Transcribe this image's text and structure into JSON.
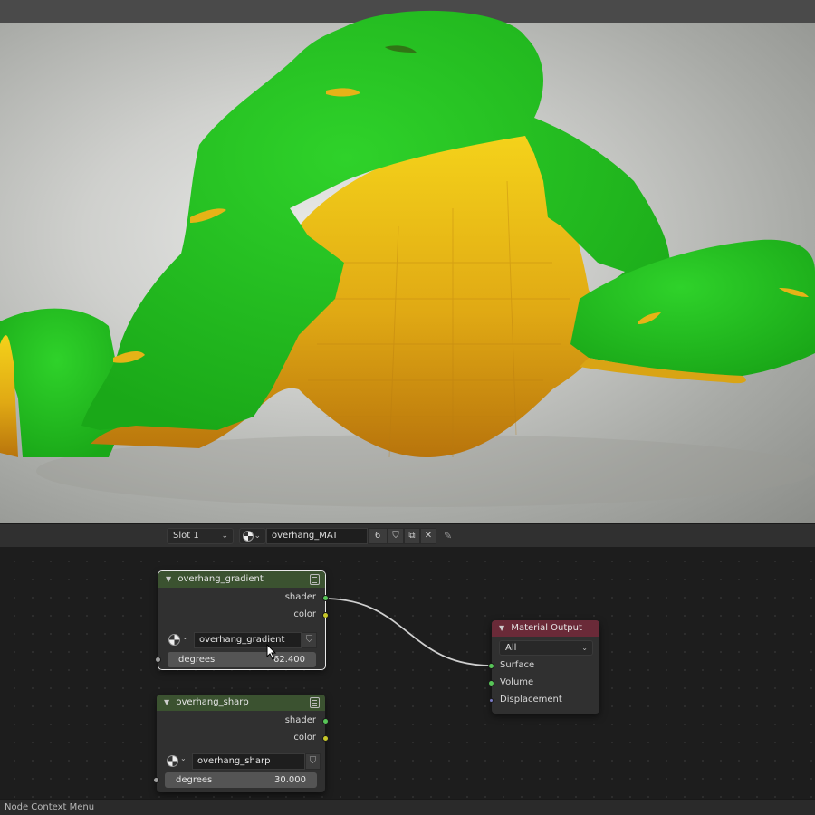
{
  "header": {
    "slot_label": "Slot 1",
    "material_name": "overhang_MAT",
    "user_count": "6"
  },
  "nodes": {
    "gradient": {
      "title": "overhang_gradient",
      "out_shader": "shader",
      "out_color": "color",
      "material": "overhang_gradient",
      "param_label": "degrees",
      "param_value": "62.400"
    },
    "sharp": {
      "title": "overhang_sharp",
      "out_shader": "shader",
      "out_color": "color",
      "material": "overhang_sharp",
      "param_label": "degrees",
      "param_value": "30.000"
    },
    "output": {
      "title": "Material Output",
      "target": "All",
      "in_surface": "Surface",
      "in_volume": "Volume",
      "in_displacement": "Displacement"
    }
  },
  "status": {
    "text": "Node Context Menu"
  },
  "colors": {
    "overhang_safe": "#22c21e",
    "overhang_warn": "#e6b317",
    "shader_socket": "#58c558",
    "color_socket": "#c7c729",
    "group_node_header": "#3b5230",
    "output_node_header": "#6a2a38"
  }
}
